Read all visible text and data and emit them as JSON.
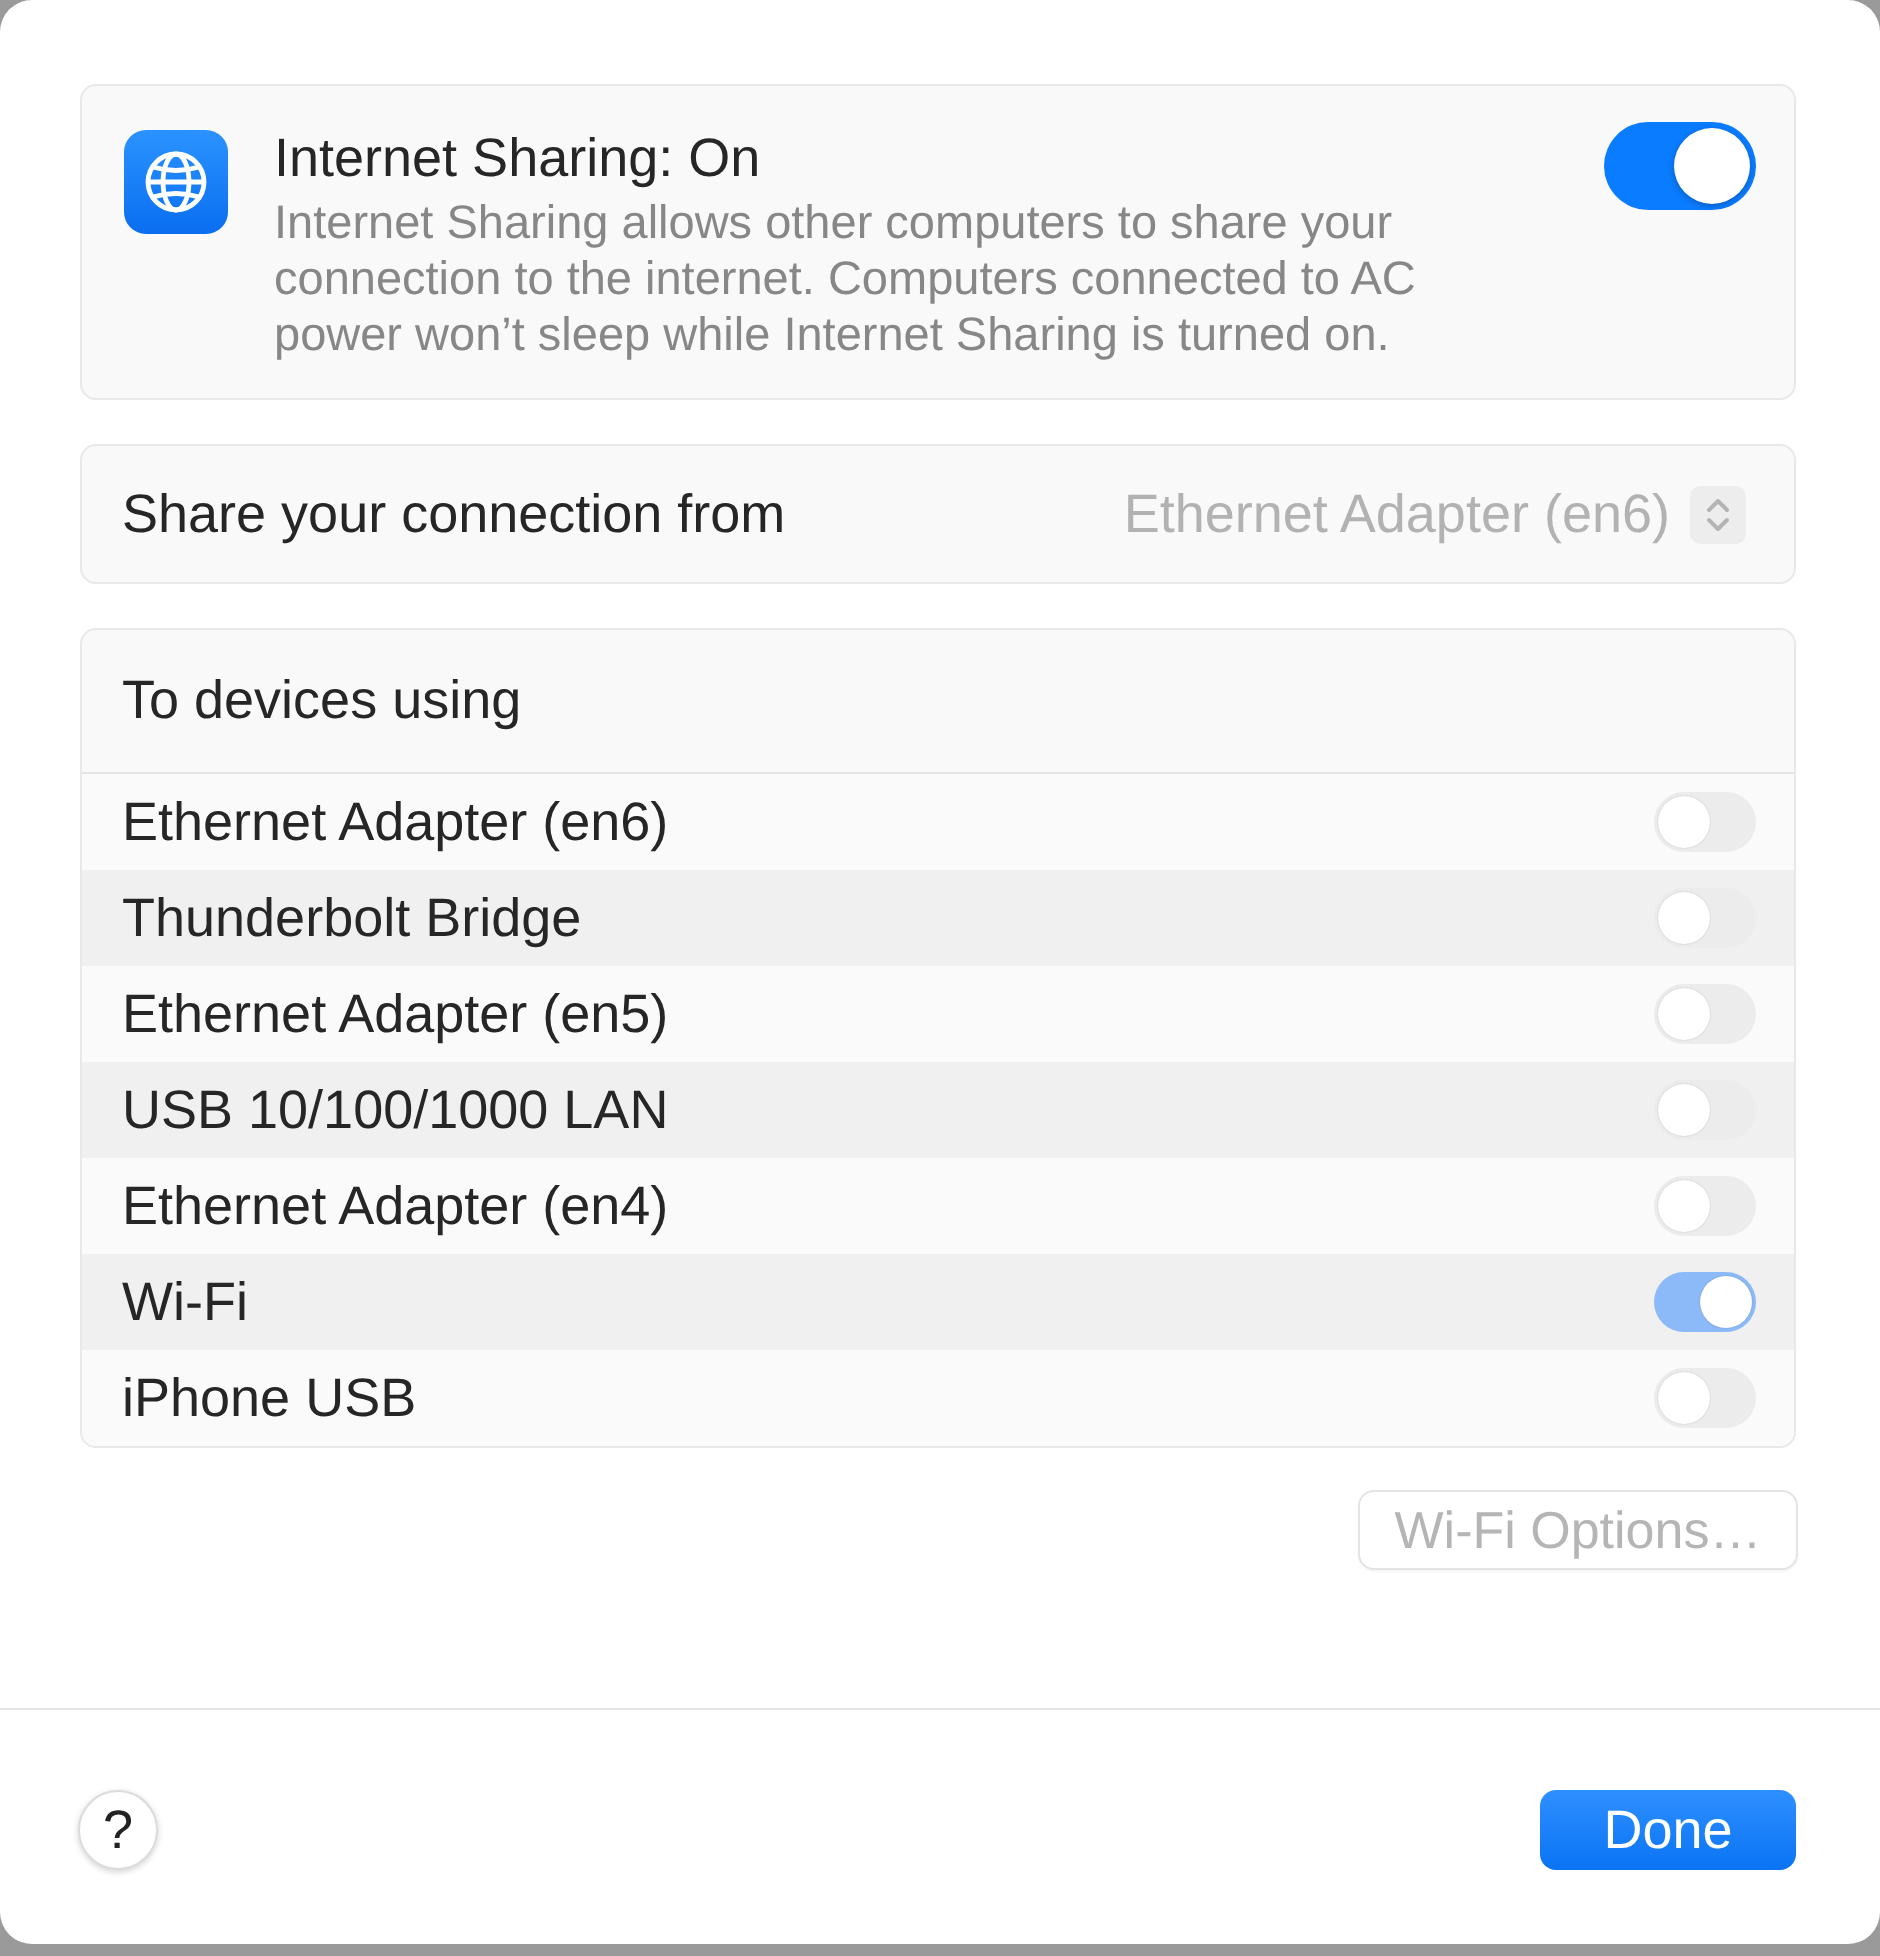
{
  "internet_sharing": {
    "title": "Internet Sharing: On",
    "description": "Internet Sharing allows other computers to share your connection to the internet. Computers connected to AC power won’t sleep while Internet Sharing is turned on.",
    "on": true
  },
  "share_from": {
    "label": "Share your connection from",
    "value": "Ethernet Adapter (en6)",
    "disabled": true
  },
  "to_devices": {
    "heading": "To devices using",
    "items": [
      {
        "label": "Ethernet Adapter (en6)",
        "on": false,
        "disabled": true
      },
      {
        "label": "Thunderbolt Bridge",
        "on": false,
        "disabled": true
      },
      {
        "label": "Ethernet Adapter (en5)",
        "on": false,
        "disabled": true
      },
      {
        "label": "USB 10/100/1000 LAN",
        "on": false,
        "disabled": true
      },
      {
        "label": "Ethernet Adapter (en4)",
        "on": false,
        "disabled": true
      },
      {
        "label": "Wi-Fi",
        "on": true,
        "disabled": true
      },
      {
        "label": "iPhone USB",
        "on": false,
        "disabled": true
      }
    ]
  },
  "wifi_options_button": {
    "label": "Wi-Fi Options…",
    "disabled": true
  },
  "help_button": {
    "label": "?"
  },
  "done_button": {
    "label": "Done"
  }
}
